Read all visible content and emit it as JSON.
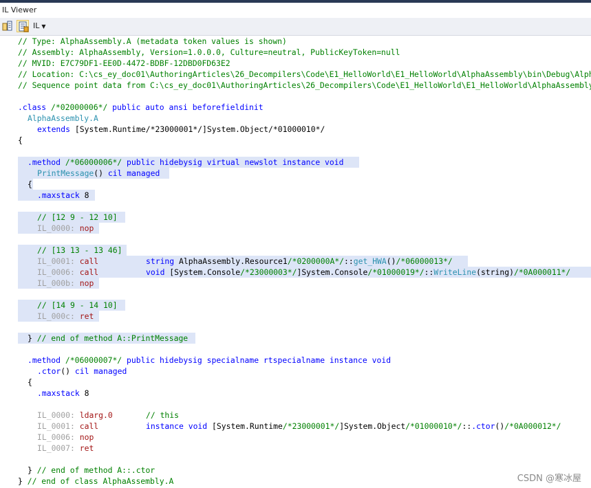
{
  "window": {
    "title": "IL Viewer"
  },
  "toolbar": {
    "language": "IL",
    "btn1_icon": "show-tokens-icon",
    "btn2_icon": "sequence-points-icon"
  },
  "header": {
    "type": "// Type: AlphaAssembly.A (metadata token values is shown)",
    "assembly": "// Assembly: AlphaAssembly, Version=1.0.0.0, Culture=neutral, PublicKeyToken=null",
    "mvid": "// MVID: E7C79DF1-EE0D-4472-BDBF-12DBD0FD63E2",
    "location": "// Location: C:\\cs_ey_doc01\\AuthoringArticles\\26_Decompilers\\Code\\E1_HelloWorld\\E1_HelloWorld\\AlphaAssembly\\bin\\Debug\\AlphaAssembly.dll",
    "sequence": "// Sequence point data from C:\\cs_ey_doc01\\AuthoringArticles\\26_Decompilers\\Code\\E1_HelloWorld\\E1_HelloWorld\\AlphaAssembly\\bin\\Debug\\AlphaAssembly.pdb"
  },
  "cls": {
    "kw": ".class",
    "token": "/*02000006*/",
    "mods": "public auto ansi beforefieldinit",
    "name": "AlphaAssembly.A",
    "extends_kw": "extends",
    "extends_val": "[System.Runtime/*23000001*/]System.Object/*01000010*/",
    "open": "{",
    "close": "}",
    "end_comment": "// end of class AlphaAssembly.A"
  },
  "m1": {
    "kw": ".method",
    "token": "/*06000006*/",
    "mods": "public hidebysig virtual newslot instance void",
    "name": "PrintMessage",
    "sig": "()",
    "cil": "cil managed",
    "open": "{",
    "maxstack_kw": ".maxstack",
    "maxstack_val": "8",
    "seq1": "// [12 9 - 12 10]",
    "i1_label": "IL_0000:",
    "i1_op": "nop",
    "seq2": "// [13 13 - 13 46]",
    "i2_label": "IL_0001:",
    "i2_op": "call",
    "i2_kw": "string",
    "i2_type": "AlphaAssembly.Resource1",
    "i2_tok": "/*0200000A*/",
    "i2_sep": "::",
    "i2_meth": "get_HWA",
    "i2_args": "()",
    "i2_tok2": "/*06000013*/",
    "i3_label": "IL_0006:",
    "i3_op": "call",
    "i3_kw": "void",
    "i3_asm": "[System.Console",
    "i3_tok": "/*23000003*/",
    "i3_type": "]System.Console",
    "i3_tok2": "/*01000019*/",
    "i3_sep": "::",
    "i3_meth": "WriteLine",
    "i3_args": "(string)",
    "i3_tok3": "/*0A000011*/",
    "i4_label": "IL_000b:",
    "i4_op": "nop",
    "seq3": "// [14 9 - 14 10]",
    "i5_label": "IL_000c:",
    "i5_op": "ret",
    "close": "}",
    "end_comment": "// end of method A::PrintMessage"
  },
  "m2": {
    "kw": ".method",
    "token": "/*06000007*/",
    "mods": "public hidebysig specialname rtspecialname instance void",
    "name": ".ctor",
    "sig": "()",
    "cil": "cil managed",
    "open": "{",
    "maxstack_kw": ".maxstack",
    "maxstack_val": "8",
    "i1_label": "IL_0000:",
    "i1_op": "ldarg.0",
    "i1_comment": "// this",
    "i2_label": "IL_0001:",
    "i2_op": "call",
    "i2_kw": "instance void",
    "i2_asm": "[System.Runtime",
    "i2_tok": "/*23000001*/",
    "i2_type": "]System.Object",
    "i2_tok2": "/*01000010*/",
    "i2_sep": "::",
    "i2_meth": ".ctor",
    "i2_args": "()",
    "i2_tok3": "/*0A000012*/",
    "i3_label": "IL_0006:",
    "i3_op": "nop",
    "i4_label": "IL_0007:",
    "i4_op": "ret",
    "close": "}",
    "end_comment": "// end of method A::.ctor"
  },
  "watermark": "CSDN @寒冰屋"
}
